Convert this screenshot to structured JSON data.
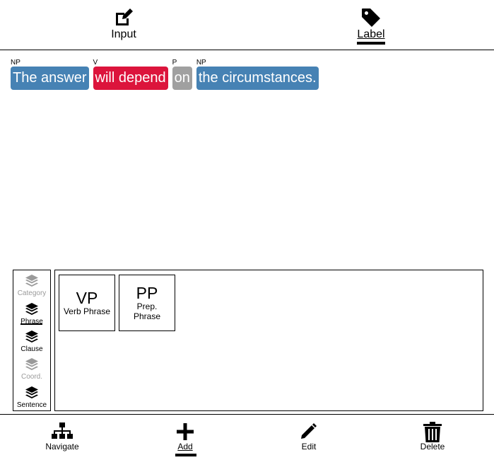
{
  "top_tabs": [
    {
      "label": "Input",
      "icon": "edit-icon",
      "active": false
    },
    {
      "label": "Label",
      "icon": "tag-icon",
      "active": true
    }
  ],
  "tokens": [
    {
      "tag": "NP",
      "text": "The answer",
      "color": "#4682B4"
    },
    {
      "tag": "V",
      "text": "will depend",
      "color": "#DC143C"
    },
    {
      "tag": "P",
      "text": "on",
      "color": "#A0A0A0"
    },
    {
      "tag": "NP",
      "text": "the circumstances.",
      "color": "#4682B4"
    }
  ],
  "categories": [
    {
      "label": "Category",
      "state": "disabled"
    },
    {
      "label": "Phrase",
      "state": "selected"
    },
    {
      "label": "Clause",
      "state": "enabled"
    },
    {
      "label": "Coord.",
      "state": "disabled"
    },
    {
      "label": "Sentence",
      "state": "enabled"
    }
  ],
  "phrases": [
    {
      "abbr": "VP",
      "name": "Verb Phrase"
    },
    {
      "abbr": "PP",
      "name_lines": [
        "Prep.",
        "Phrase"
      ]
    }
  ],
  "bottom_actions": [
    {
      "label": "Navigate",
      "icon": "sitemap-icon",
      "active": false
    },
    {
      "label": "Add",
      "icon": "plus-icon",
      "active": true
    },
    {
      "label": "Edit",
      "icon": "pencil-icon",
      "active": false
    },
    {
      "label": "Delete",
      "icon": "trash-icon",
      "active": false
    }
  ]
}
